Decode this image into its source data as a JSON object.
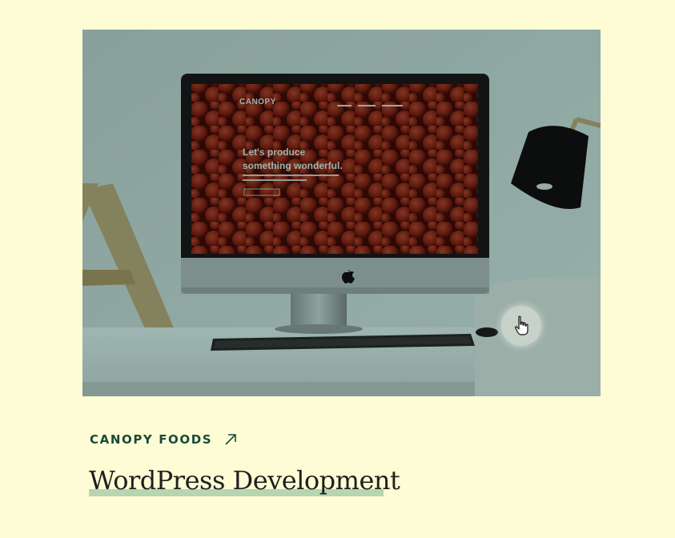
{
  "project": {
    "client": "CANOPY FOODS",
    "title": "WordPress Development"
  },
  "mockup_screen": {
    "logo": "CANOPY",
    "headline_line1": "Let's produce",
    "headline_line2": "something wonderful."
  },
  "colors": {
    "page_background": "#fefcd4",
    "client_text": "#184a3a",
    "title_text": "#1f1f1f",
    "title_underline": "#b7d5b0",
    "image_tint": "#1a5652"
  },
  "icons": {
    "external_link": "arrow-up-right-icon",
    "pointer": "hand-pointer-icon",
    "brand": "apple-logo-icon"
  }
}
